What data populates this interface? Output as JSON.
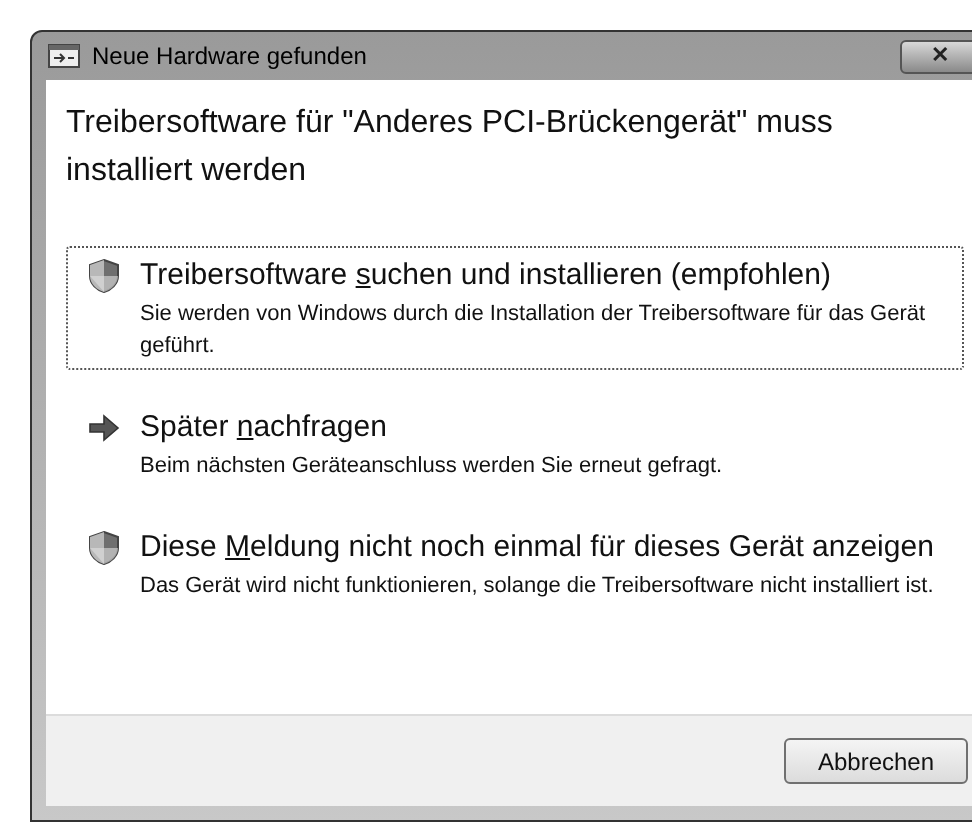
{
  "window": {
    "title": "Neue Hardware gefunden",
    "close": "✕"
  },
  "heading": "Treibersoftware für \"Anderes PCI-Brückengerät\" muss installiert werden",
  "options": [
    {
      "kind": "shield",
      "focused": true,
      "title_before": "Treibersoftware ",
      "access_key": "s",
      "title_after": "uchen und installieren (empfohlen)",
      "description": "Sie werden von Windows durch die Installation der Treibersoftware für das Gerät geführt."
    },
    {
      "kind": "arrow",
      "focused": false,
      "title_before": "Später ",
      "access_key": "n",
      "title_after": "achfragen",
      "description": "Beim nächsten Geräteanschluss werden Sie erneut gefragt."
    },
    {
      "kind": "shield",
      "focused": false,
      "title_before": "Diese ",
      "access_key": "M",
      "title_after": "eldung nicht noch einmal für dieses Gerät anzeigen",
      "description": "Das Gerät wird nicht funktionieren, solange die Treibersoftware nicht installiert ist."
    }
  ],
  "buttons": [
    "Abbrechen"
  ]
}
